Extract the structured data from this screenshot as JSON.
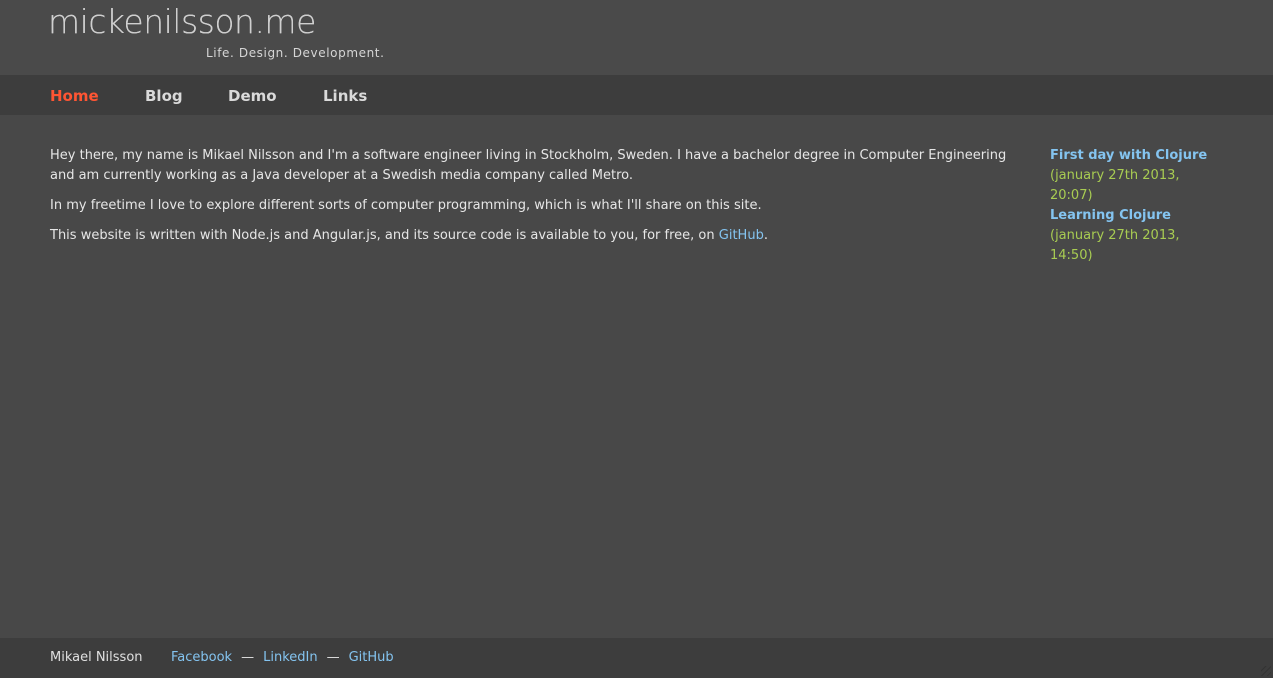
{
  "header": {
    "logo": "mickenilsson.me",
    "tagline": "Life. Design. Development."
  },
  "nav": {
    "items": [
      {
        "label": "Home",
        "active": true
      },
      {
        "label": "Blog",
        "active": false
      },
      {
        "label": "Demo",
        "active": false
      },
      {
        "label": "Links",
        "active": false
      }
    ]
  },
  "main": {
    "paragraph_1": "Hey there, my name is Mikael Nilsson and I'm a software engineer living in Stockholm, Sweden. I have a bachelor degree in Computer Engineering and am currently working as a Java developer at a Swedish media company called Metro.",
    "paragraph_2": "In my freetime I love to explore different sorts of computer programming, which is what I'll share on this site.",
    "paragraph_3_prefix": "This website is written with Node.js and Angular.js, and its source code is available to you, for free, on ",
    "paragraph_3_link": "GitHub",
    "paragraph_3_suffix": "."
  },
  "sidebar": {
    "posts": [
      {
        "title": "First day with Clojure",
        "date": "(january 27th 2013, 20:07)"
      },
      {
        "title": "Learning Clojure",
        "date": "(january 27th 2013, 14:50)"
      }
    ]
  },
  "footer": {
    "name": "Mikael Nilsson",
    "links": [
      "Facebook",
      "LinkedIn",
      "GitHub"
    ],
    "separator": "—"
  },
  "colors": {
    "accent_active": "#ff5533",
    "link": "#84c4f0",
    "date": "#a8cc52",
    "background": "#484848",
    "bar": "#3d3d3d"
  }
}
